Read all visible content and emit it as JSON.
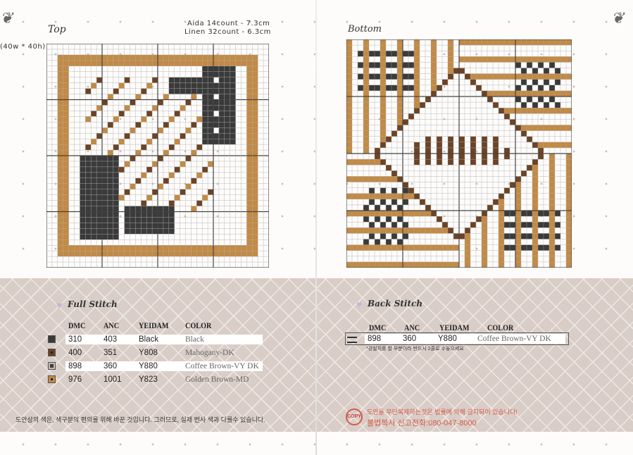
{
  "header": {
    "top_label": "Top",
    "bottom_label": "Bottom",
    "size_note": "(40w * 40h)",
    "aida": "Aida 14count - 7.3cm",
    "linen": "Linen 32count - 6.3cm"
  },
  "full_stitch": {
    "title": "Full Stitch",
    "columns": [
      "DMC",
      "ANC",
      "YEIDAM",
      "COLOR"
    ],
    "rows": [
      {
        "dmc": "310",
        "anc": "403",
        "yeidam": "Black",
        "color": "Black",
        "swatch": "#3a3a3a",
        "symbol": "solid"
      },
      {
        "dmc": "400",
        "anc": "351",
        "yeidam": "Y808",
        "color": "Mahogany-DK",
        "swatch": "#6b4326",
        "symbol": "dot"
      },
      {
        "dmc": "898",
        "anc": "360",
        "yeidam": "Y880",
        "color": "Coffee Brown-VY DK",
        "swatch": "#4a3a2c",
        "symbol": "square"
      },
      {
        "dmc": "976",
        "anc": "1001",
        "yeidam": "Y823",
        "color": "Golden Brown-MD",
        "swatch": "#c28a45",
        "symbol": "dot"
      }
    ]
  },
  "back_stitch": {
    "title": "Back Stitch",
    "columns": [
      "DMC",
      "ANC",
      "YEIDAM",
      "COLOR"
    ],
    "rows": [
      {
        "dmc": "898",
        "anc": "360",
        "yeidam": "Y880",
        "color": "Coffee Brown-VY DK"
      }
    ],
    "note": "*강철치를 할 부분이라 반드시 2줄로 수놓으세요"
  },
  "footer": {
    "color_note": "도안상의 색은, 색구분의 편의를 위해 바꾼 것입니다. 그러므로, 실제 번사 색과 다를수 있습니다.",
    "copy_badge": "COPY",
    "copy_warning": "도안을 무단복제하는것은 법률에 의해 금지되어 있습니다!",
    "report_line": "불법복사 신고전화:080-047-8000"
  },
  "colors": {
    "black": "#3a3a3a",
    "golden": "#c28a45",
    "mahogany": "#6b4326",
    "lattice": "#d9cdc7"
  }
}
